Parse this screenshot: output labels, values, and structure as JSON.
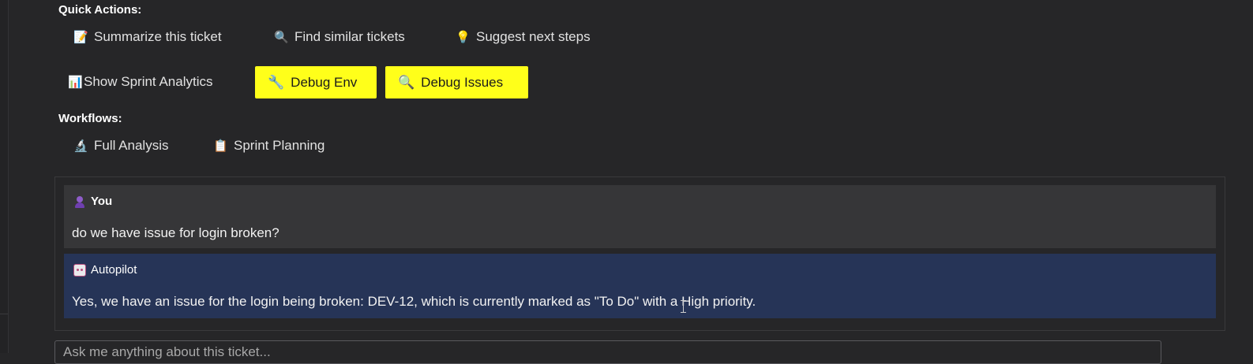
{
  "quick_actions": {
    "label": "Quick Actions:",
    "items": [
      {
        "icon": "memo-icon",
        "glyph": "📝",
        "label": "Summarize this ticket"
      },
      {
        "icon": "magnifier-icon",
        "glyph": "🔍",
        "label": "Find similar tickets"
      },
      {
        "icon": "lightbulb-icon",
        "glyph": "💡",
        "label": "Suggest next steps"
      }
    ],
    "analytics": {
      "icon": "bar-chart-icon",
      "glyph": "📊",
      "label": "Show Sprint Analytics"
    },
    "debug_env": {
      "icon": "wrench-icon",
      "glyph": "🔧",
      "label": "Debug Env"
    },
    "debug_issues": {
      "icon": "magnifier-icon",
      "glyph": "🔍",
      "label": "Debug Issues"
    },
    "highlight_color": "#ffff1a"
  },
  "workflows": {
    "label": "Workflows:",
    "items": [
      {
        "icon": "microscope-icon",
        "glyph": "🔬",
        "label": "Full Analysis"
      },
      {
        "icon": "clipboard-icon",
        "glyph": "📋",
        "label": "Sprint Planning"
      }
    ]
  },
  "chat": {
    "messages": [
      {
        "sender": "You",
        "avatar": "user-icon",
        "text": "do we have issue for login broken?"
      },
      {
        "sender": "Autopilot",
        "avatar": "robot-icon",
        "text": "Yes, we have an issue for the login being broken: DEV-12, which is currently marked as \"To Do\" with a High priority."
      }
    ],
    "bot_bubble_color": "#263457",
    "user_bubble_color": "#363638"
  },
  "input": {
    "placeholder": "Ask me anything about this ticket..."
  }
}
